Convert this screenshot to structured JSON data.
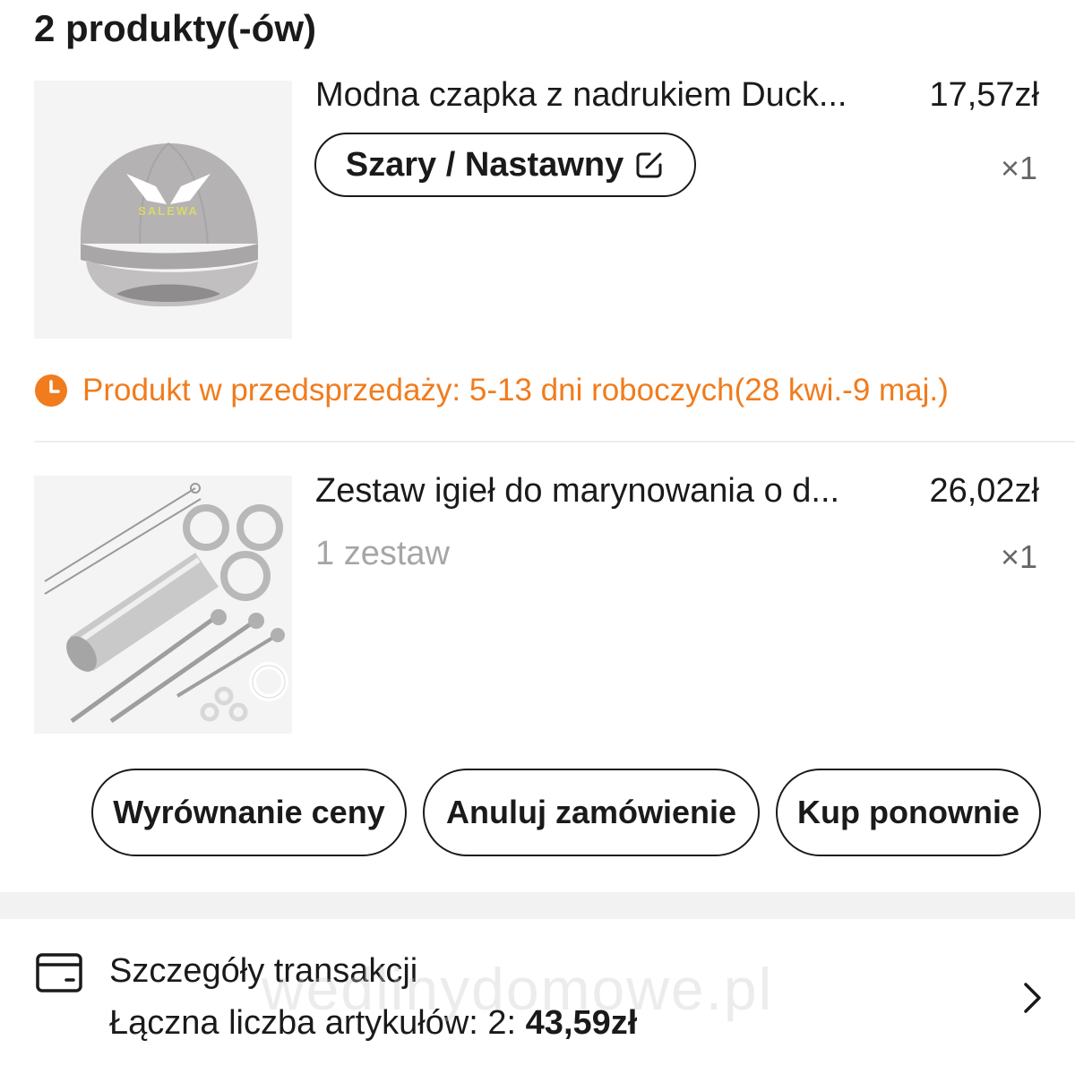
{
  "header": {
    "title": "2 produkty(-ów)"
  },
  "products": [
    {
      "title": "Modna czapka z nadrukiem Duck...",
      "price": "17,57zł",
      "variant": "Szary / Nastawny",
      "quantity": "×1",
      "image_label": "SALEWA"
    },
    {
      "title": "Zestaw igieł do marynowania o d...",
      "price": "26,02zł",
      "variant": "1 zestaw",
      "quantity": "×1"
    }
  ],
  "presale": {
    "text": "Produkt w przedsprzedaży: 5-13 dni roboczych(28 kwi.-9 maj.)"
  },
  "actions": {
    "price_adjust": "Wyrównanie ceny",
    "cancel_order": "Anuluj zamówienie",
    "buy_again": "Kup ponownie"
  },
  "transaction": {
    "title": "Szczegóły transakcji",
    "items_label": "Łączna liczba artykułów: 2: ",
    "total": "43,59zł"
  },
  "watermark": "wedlinydomowe.pl",
  "colors": {
    "presale_orange": "#f07c1d",
    "text_primary": "#1a1a1a",
    "text_muted": "#a6a6a6"
  }
}
